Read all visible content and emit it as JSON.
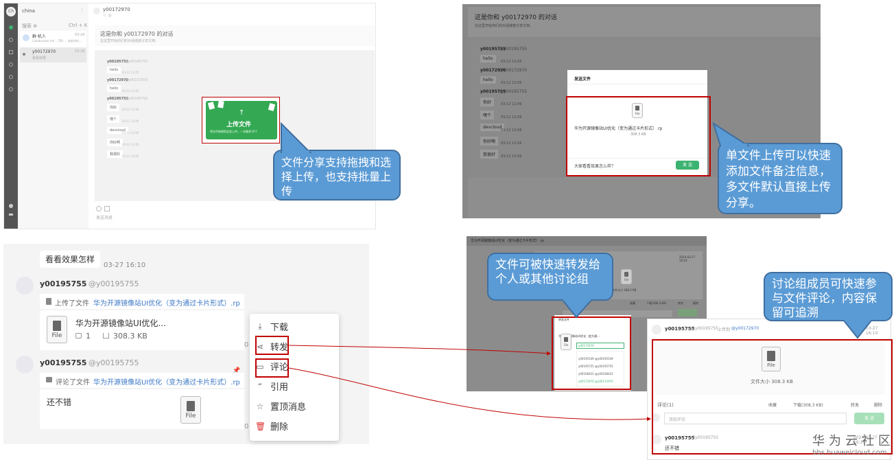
{
  "p1": {
    "logo": "Ch",
    "sidebar_title": "china",
    "search_hint": "搜索 ⊕",
    "new_chat": "Ctrl + K",
    "convos": [
      {
        "name": "群·机人",
        "preview": "Collaborator bot ...TBS ... 发给你的...",
        "time": "03-26"
      },
      {
        "name": "y00172970",
        "preview": "看看效果",
        "time": "03-26"
      }
    ],
    "header_user": "y00172970",
    "header_sub": "☆ ◎",
    "conv_title": "这是你和 y00172970 的对话",
    "conv_desc": "在这里开始你们的对话或者分享文档..",
    "msgs": [
      {
        "user": "y00195755",
        "handle": "@y00195755",
        "text": "hello",
        "time": "03-12 12:05"
      },
      {
        "user": "y00172970",
        "handle": "@y00172970",
        "text": "hello",
        "time": "03-12 12:05"
      },
      {
        "user": "y00195755",
        "handle": "@y00195755",
        "text": "你好",
        "time": "03-12 12:06"
      },
      {
        "user": "",
        "handle": "",
        "text": "嘿个",
        "time": "03-12 12:06"
      },
      {
        "user": "",
        "handle": "",
        "text": "devcloud",
        "time": "03-12 12:06"
      },
      {
        "user": "",
        "handle": "",
        "text": "你好啊",
        "time": "03-12 12:06"
      },
      {
        "user": "",
        "handle": "",
        "text": "我很好",
        "time": "03-12 12:06"
      }
    ],
    "upload_text": "上传文件",
    "upload_hint": "将文件拖拽到这里上传，一次最多10个",
    "input_placeholder": "发送消息"
  },
  "callout1": "文件分享支持拖拽和选择上传，也支持批量上传",
  "p2": {
    "conv_title": "这是你和 y00172970 的对话",
    "conv_desc": "在这里开始你们的对话或者分享文档..",
    "msgs": [
      {
        "user": "y00195755",
        "handle": "@y00195755",
        "text": "hello",
        "time": "03-12 12:05"
      },
      {
        "user": "y00172970",
        "handle": "@y00172970",
        "text": "hello",
        "time": "03-12 12:05"
      },
      {
        "user": "y00195755",
        "handle": "@y00195755",
        "text": "你好",
        "time": "03-12 12:06"
      },
      {
        "user": "",
        "handle": "",
        "text": "嘿个",
        "time": "03-12 12:06"
      },
      {
        "user": "",
        "handle": "",
        "text": "devcloud",
        "time": "03-12 12:06"
      },
      {
        "user": "",
        "handle": "",
        "text": "你好啊",
        "time": "03-12 12:06"
      },
      {
        "user": "",
        "handle": "",
        "text": "我很好",
        "time": "03-12 12:06"
      }
    ],
    "dialog_title": "发送文件",
    "file_label": "File",
    "file_name": "华为开源镜像站UI优化（变为通过卡片形式）.rp",
    "file_size": "308.3 KB",
    "note": "大家看看效果怎么样？",
    "send": "发 送"
  },
  "callout2": "单文件上传可以快速添加文件备注信息，多文件默认直接上传分享。",
  "p3": {
    "prev_text": "看看效果怎样",
    "prev_time": "03-27 16:10",
    "m1_user": "y00195755",
    "m1_handle": "@y00195755",
    "m1_action": "上传了文件",
    "m1_link": "华为开源镜像站UI优化（变为通过卡片形式）.rp",
    "card_name": "华为开源镜像站UI优化...",
    "card_comments": "1",
    "card_size": "308.3 KB",
    "file_label": "File",
    "m2_user": "y00195755",
    "m2_handle": "@y00195755",
    "m2_action": "评论了文件",
    "m2_link": "华为开源镜像站UI优化（变为通过卡片形式）.rp",
    "m2_text": "还不错",
    "menu": [
      "下载",
      "转发",
      "评论",
      "引用",
      "置顶消息",
      "删除"
    ],
    "side_letter": "0"
  },
  "p4": {
    "header": "华为开源镜像站UI优化（变为通过卡片形式）.rp",
    "time": "2024-03-27 16:10",
    "file_label": "File",
    "size": "文件大小 308.3 KB",
    "actions": [
      "收藏",
      "下载(308.3 KB)",
      "转发",
      "删除"
    ],
    "fwd_title": "转发文件",
    "fwd_file": "华为开源镜像站UI优化（变为通...",
    "fwd_search": "y00172970",
    "fwd_list": [
      "y00195549 @y00195549",
      "y00195755 @y00195755",
      "y00168422 @y00168422",
      "y00172970 @y00172970"
    ]
  },
  "callout3": "文件可被快速转发给个人或其他讨论组",
  "p5": {
    "user": "y00195755",
    "handle": "@y00195755",
    "action": "上传到",
    "target": "@y00172970",
    "time": "03-27 16:10",
    "file_label": "File",
    "size": "文件大小 308.3 KB",
    "comments": "评论(1)",
    "actions": [
      "收藏",
      "下载(308.3 KB)",
      "转发",
      "删除"
    ],
    "comment_placeholder": "添加评论",
    "send": "发 送",
    "c_user": "y00195755",
    "c_handle": "@y00195755",
    "c_text": "还不错",
    "c_time": "2024-03-27 16:10"
  },
  "callout4": "讨论组成员可快速参与文件评论，内容保留可追溯",
  "watermark": {
    "line1": "华为云社区",
    "line2": "bbs.huaweicloud.com"
  }
}
